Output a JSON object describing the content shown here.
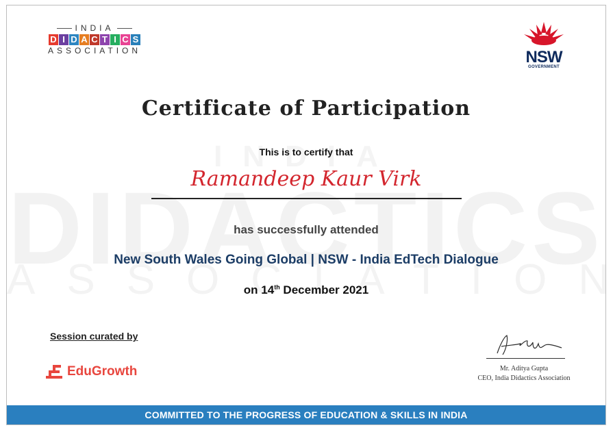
{
  "logos": {
    "ida": {
      "top": "INDIA",
      "middle": [
        "D",
        "I",
        "D",
        "A",
        "C",
        "T",
        "I",
        "C",
        "S"
      ],
      "middle_colors": [
        "#e63c2f",
        "#6b3fa0",
        "#2e86c1",
        "#e67e22",
        "#c0392b",
        "#8e44ad",
        "#27ae60",
        "#e84393",
        "#2980b9"
      ],
      "bottom": "ASSOCIATION"
    },
    "nsw": {
      "word": "NSW",
      "sub": "GOVERNMENT"
    }
  },
  "watermark": {
    "top": "INDIA",
    "middle": "DIDACTICS",
    "bottom": "ASSOCIATION"
  },
  "certificate": {
    "title": "Certificate of Participation",
    "certify_line": "This is to certify that",
    "recipient": "Ramandeep Kaur Virk",
    "attended_line": "has successfully attended",
    "event": "New South Wales Going Global | NSW - India EdTech Dialogue",
    "date_prefix": "on 14",
    "date_suffix": "th",
    "date_rest": " December 2021"
  },
  "curation": {
    "label": "Session curated by",
    "org": "EduGrowth"
  },
  "signatory": {
    "name": "Mr. Aditya Gupta",
    "title": "CEO, India Didactics Association"
  },
  "footer": "COMMITTED TO THE PROGRESS OF EDUCATION & SKILLS IN INDIA",
  "colors": {
    "accent_red": "#d3262e",
    "navy": "#1c3d66",
    "footer_blue": "#2a7fbf",
    "edugrowth": "#e8463e"
  }
}
